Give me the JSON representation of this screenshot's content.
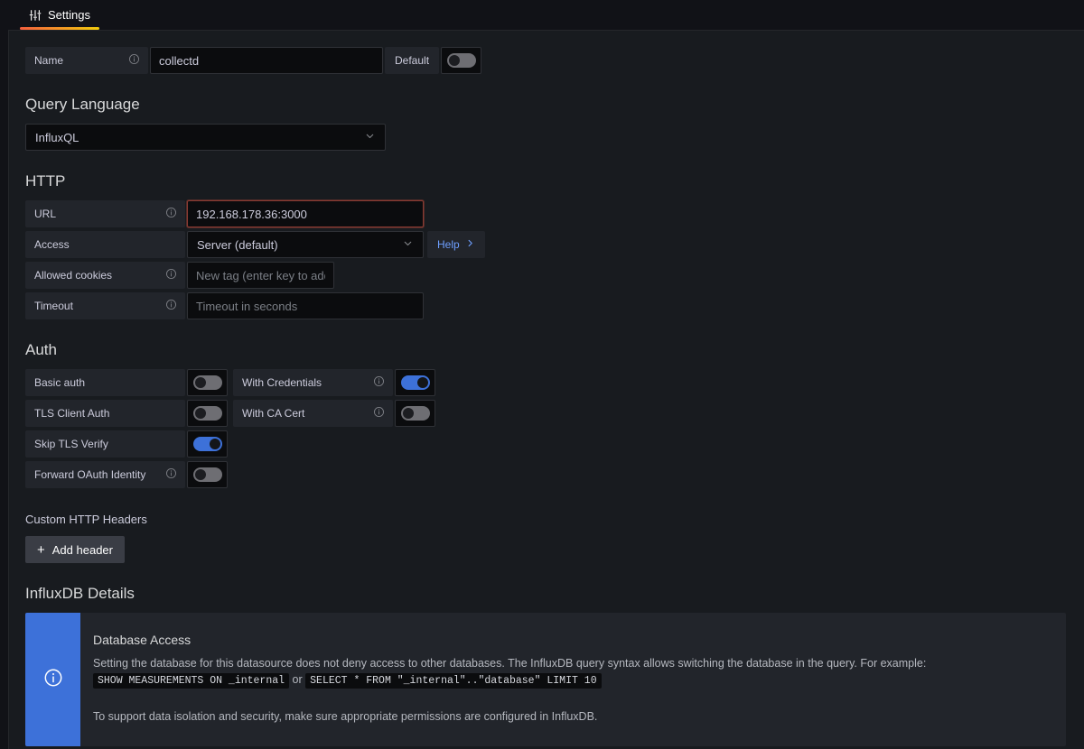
{
  "tab": {
    "label": "Settings",
    "icon": "sliders-icon",
    "accent_start": "#f55f3e",
    "accent_end": "#f2cc0c"
  },
  "name_row": {
    "label": "Name",
    "value": "collectd",
    "default_label": "Default",
    "default_on": false
  },
  "query_language": {
    "heading": "Query Language",
    "selected": "InfluxQL"
  },
  "http": {
    "heading": "HTTP",
    "url": {
      "label": "URL",
      "value": "192.168.178.36:3000",
      "error": true
    },
    "access": {
      "label": "Access",
      "selected": "Server (default)",
      "help_label": "Help"
    },
    "allowed_cookies": {
      "label": "Allowed cookies",
      "value": "",
      "placeholder": "New tag (enter key to add)"
    },
    "timeout": {
      "label": "Timeout",
      "value": "",
      "placeholder": "Timeout in seconds"
    }
  },
  "auth": {
    "heading": "Auth",
    "left": [
      {
        "label": "Basic auth",
        "on": false,
        "info": false
      },
      {
        "label": "TLS Client Auth",
        "on": false,
        "info": false
      },
      {
        "label": "Skip TLS Verify",
        "on": true,
        "info": false
      },
      {
        "label": "Forward OAuth Identity",
        "on": false,
        "info": true
      }
    ],
    "right": [
      {
        "label": "With Credentials",
        "on": true,
        "info": true
      },
      {
        "label": "With CA Cert",
        "on": false,
        "info": true
      }
    ]
  },
  "custom_headers": {
    "heading": "Custom HTTP Headers",
    "add_button": "Add header"
  },
  "influx_details": {
    "heading": "InfluxDB Details",
    "alert": {
      "title": "Database Access",
      "paragraph1_a": "Setting the database for this datasource does not deny access to other databases. The InfluxDB query syntax allows switching the database in the query. For example:",
      "code1": "SHOW MEASUREMENTS ON _internal",
      "paragraph1_b": "or",
      "code2": "SELECT * FROM \"_internal\"..\"database\" LIMIT 10",
      "paragraph2": "To support data isolation and security, make sure appropriate permissions are configured in InfluxDB.",
      "accent": "#3d71d9"
    }
  }
}
